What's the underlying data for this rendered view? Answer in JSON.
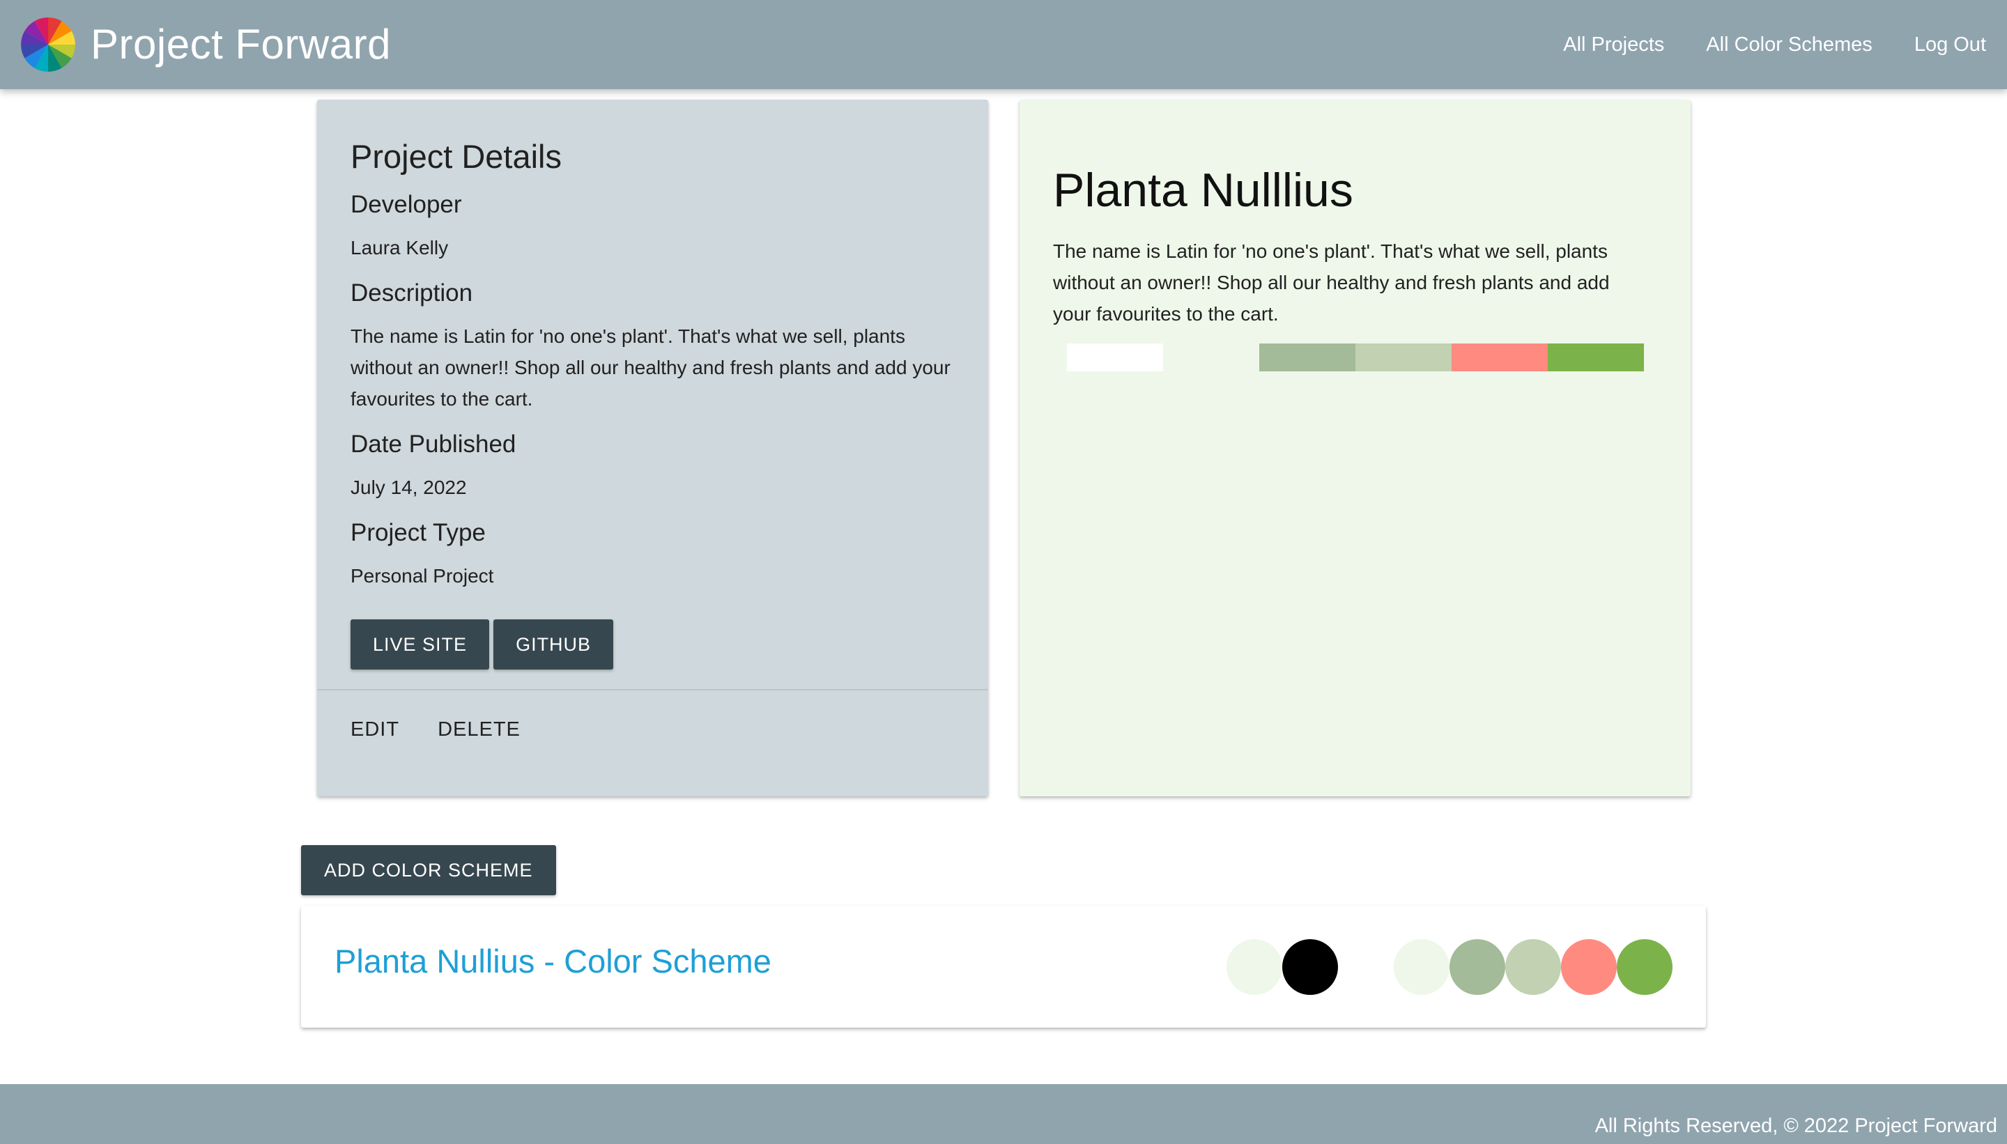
{
  "header": {
    "brand": "Project Forward",
    "nav": [
      "All Projects",
      "All Color Schemes",
      "Log Out"
    ]
  },
  "details": {
    "title": "Project Details",
    "developer_label": "Developer",
    "developer": "Laura Kelly",
    "description_label": "Description",
    "description": "The name is Latin for 'no one's plant'. That's what we sell, plants without an owner!! Shop all our healthy and fresh plants and add your favourites to the cart.",
    "date_label": "Date Published",
    "date": "July 14, 2022",
    "type_label": "Project Type",
    "type": "Personal Project",
    "live_site_label": "LIVE SITE",
    "github_label": "GITHUB",
    "edit_label": "EDIT",
    "delete_label": "DELETE"
  },
  "preview": {
    "title": "Planta Nulllius",
    "description": "The name is Latin for 'no one's plant'. That's what we sell, plants without an owner!! Shop all our healthy and fresh plants and add your favourites to the cart.",
    "strip_colors": [
      "#ffffff",
      "#eef7e9",
      "#a3bb98",
      "#c1d1b1",
      "#ff8a80",
      "#7cb24a"
    ]
  },
  "add_scheme_label": "ADD COLOR SCHEME",
  "scheme": {
    "name": "Planta Nullius - Color Scheme",
    "colors": [
      "#eef7e9",
      "#000000",
      "#ffffff",
      "#eef7e9",
      "#a3bb98",
      "#c1d1b1",
      "#ff8a80",
      "#7cb24a"
    ]
  },
  "footer": {
    "text": "All Rights Reserved, © 2022 Project Forward"
  },
  "theme": {
    "navbar": "#90a4ae",
    "button": "#37474f",
    "details_bg": "#cfd8dc",
    "link": "#1e9fd6"
  }
}
